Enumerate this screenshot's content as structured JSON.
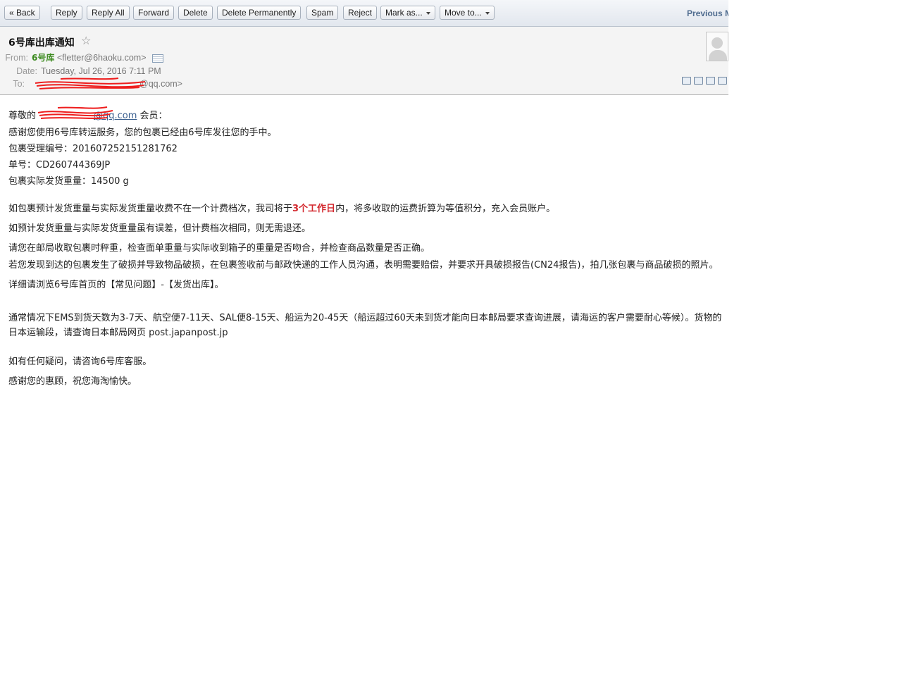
{
  "toolbar": {
    "back": "« Back",
    "reply": "Reply",
    "reply_all": "Reply All",
    "forward": "Forward",
    "delete": "Delete",
    "delete_permanently": "Delete Permanently",
    "spam": "Spam",
    "reject": "Reject",
    "mark_as": "Mark as...",
    "move_to": "Move to...",
    "previous": "Previous M"
  },
  "message": {
    "subject": "6号库出库通知",
    "from_label": "From:",
    "from_name": "6号库",
    "from_email": "<fletter@6haoku.com>",
    "date_label": "Date:",
    "date": "Tuesday, Jul 26, 2016 7:11 PM",
    "to_label": "To:",
    "to_value": "@qq.com>"
  },
  "body": {
    "greeting_prefix": "尊敬的",
    "greeting_email": "@qq.com",
    "greeting_suffix": " 会员：",
    "line1": "感谢您使用6号库转运服务，您的包裹已经由6号库发往您的手中。",
    "line2": "包裹受理编号：201607252151281762",
    "line3": "单号：CD260744369JP",
    "line4": "包裹实际发货重量：14500 g",
    "para1_before": "如包裹预计发货重量与实际发货重量收费不在一个计费档次，我司将于",
    "para1_highlight": "3个工作日",
    "para1_after": "内，将多收取的运费折算为等值积分，充入会员账户。",
    "para2": "如预计发货重量与实际发货重量虽有误差，但计费档次相同，则无需退还。",
    "para3": "请您在邮局收取包裹时秤重，检查面单重量与实际收到箱子的重量是否吻合，并检查商品数量是否正确。",
    "para4": "若您发现到达的包裹发生了破损并导致物品破损，在包裹签收前与邮政快递的工作人员沟通，表明需要赔偿，并要求开具破损报告(CN24报告)，拍几张包裹与商品破损的照片。详细请浏览6号库首页的【常见问题】-【发货出库】。",
    "para5": "通常情况下EMS到货天数为3-7天、航空便7-11天、SAL便8-15天、船运为20-45天（船运超过60天未到货才能向日本邮局要求查询进展，请海运的客户需要耐心等候）。货物的日本运输段，请查询日本邮局网页 post.japanpost.jp",
    "para6": "如有任何疑问，请咨询6号库客服。",
    "para7": "感谢您的惠顾，祝您海淘愉快。"
  }
}
